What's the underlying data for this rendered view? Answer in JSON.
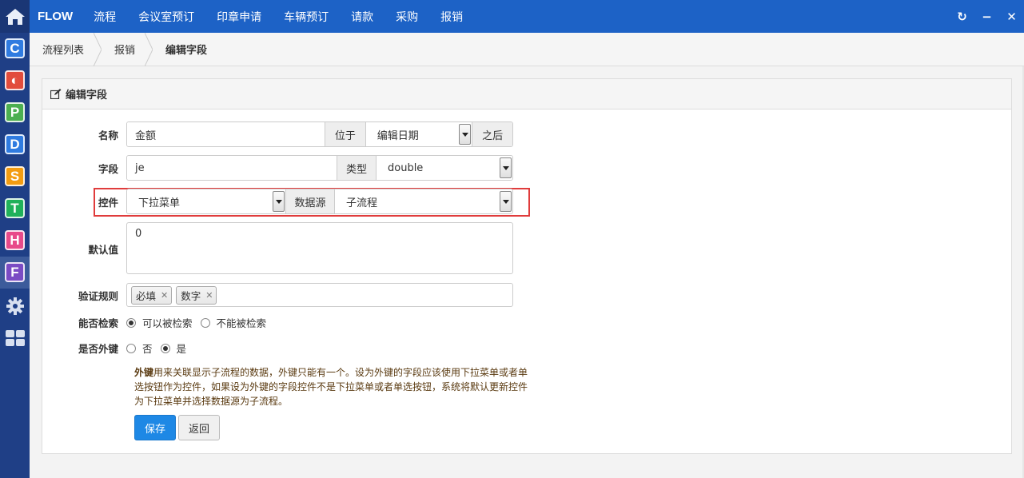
{
  "colors": {
    "topbar": "#1d62c6",
    "dock": "#1f3f86",
    "primary_button": "#1e88e5",
    "highlight_border": "#e03c3c"
  },
  "dock": {
    "home_icon": "home-icon",
    "apps": [
      {
        "letter": "C",
        "color": "#2f7be0",
        "name": "app-c-icon"
      },
      {
        "letter": "◐",
        "color": "#e24c3c",
        "name": "app-red-icon"
      },
      {
        "letter": "P",
        "color": "#4caf50",
        "name": "app-p-icon"
      },
      {
        "letter": "D",
        "color": "#2f7be0",
        "name": "app-d-icon"
      },
      {
        "letter": "S",
        "color": "#f39c12",
        "name": "app-s-icon"
      },
      {
        "letter": "T",
        "color": "#20b15a",
        "name": "app-t-icon"
      },
      {
        "letter": "H",
        "color": "#e84a8a",
        "name": "app-h-icon"
      },
      {
        "letter": "F",
        "color": "#7b4bc4",
        "name": "app-f-icon"
      }
    ],
    "tools": [
      "settings-icon",
      "grid-icon"
    ]
  },
  "topbar": {
    "brand": "FLOW",
    "nav": [
      "流程",
      "会议室预订",
      "印章申请",
      "车辆预订",
      "请款",
      "采购",
      "报销"
    ],
    "controls": {
      "refresh": "↻",
      "minimize": "−",
      "close": "✕"
    }
  },
  "breadcrumb": [
    "流程列表",
    "报销",
    "编辑字段"
  ],
  "panel": {
    "title": "编辑字段",
    "fields": {
      "name": {
        "label": "名称",
        "value": "金额",
        "position_label": "位于",
        "position_value": "编辑日期",
        "after_label": "之后"
      },
      "field": {
        "label": "字段",
        "value": "je",
        "type_label": "类型",
        "type_value": "double"
      },
      "control": {
        "label": "控件",
        "value": "下拉菜单",
        "source_label": "数据源",
        "source_value": "子流程"
      },
      "default": {
        "label": "默认值",
        "value": "0"
      },
      "validation": {
        "label": "验证规则",
        "tags": [
          "必填",
          "数字"
        ]
      },
      "searchable": {
        "label": "能否检索",
        "options": [
          "可以被检索",
          "不能被检索"
        ],
        "selected": 0
      },
      "foreign_key": {
        "label": "是否外键",
        "options": [
          "否",
          "是"
        ],
        "selected": 1
      }
    },
    "note_bold": "外键",
    "note_text": "用来关联显示子流程的数据，外键只能有一个。设为外键的字段应该使用下拉菜单或者单选按钮作为控件，如果设为外键的字段控件不是下拉菜单或者单选按钮，系统将默认更新控件为下拉菜单并选择数据源为子流程。",
    "save_label": "保存",
    "back_label": "返回"
  }
}
